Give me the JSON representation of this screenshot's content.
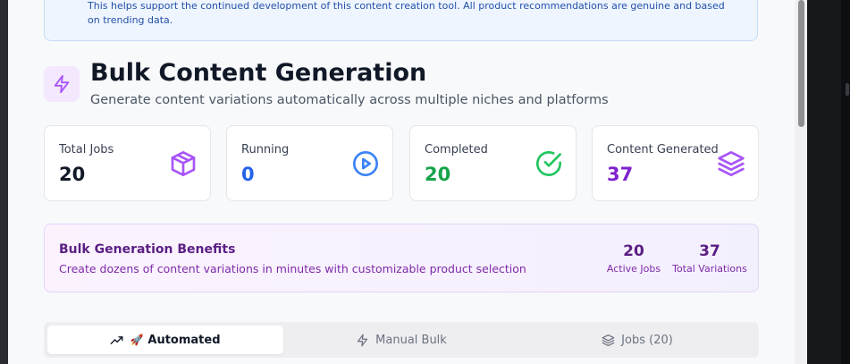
{
  "notice": {
    "text": "This helps support the continued development of this content creation tool. All product recommendations are genuine and based on trending data."
  },
  "header": {
    "title": "Bulk Content Generation",
    "subtitle": "Generate content variations automatically across multiple niches and platforms",
    "icon": "zap-icon"
  },
  "stats": [
    {
      "label": "Total Jobs",
      "value": "20",
      "icon": "box-icon",
      "color": "#111827",
      "icon_color": "#a855f7"
    },
    {
      "label": "Running",
      "value": "0",
      "icon": "play-circle-icon",
      "color": "#2563eb",
      "icon_color": "#3b82f6"
    },
    {
      "label": "Completed",
      "value": "20",
      "icon": "check-circle-icon",
      "color": "#16a34a",
      "icon_color": "#22c55e"
    },
    {
      "label": "Content Generated",
      "value": "37",
      "icon": "layers-icon",
      "color": "#7e22ce",
      "icon_color": "#a855f7"
    }
  ],
  "benefits": {
    "title": "Bulk Generation Benefits",
    "description": "Create dozens of content variations in minutes with customizable product selection",
    "active_jobs_value": "20",
    "active_jobs_label": "Active Jobs",
    "total_variations_value": "37",
    "total_variations_label": "Total Variations"
  },
  "tabs": [
    {
      "label": "Automated",
      "icon": "trending-up-icon",
      "emoji": "🚀",
      "active": true
    },
    {
      "label": "Manual Bulk",
      "icon": "zap-icon",
      "active": false
    },
    {
      "label": "Jobs (20)",
      "icon": "layers-icon",
      "active": false
    }
  ],
  "colors": {
    "accent_purple": "#a855f7",
    "notice_blue": "#2350a8"
  }
}
